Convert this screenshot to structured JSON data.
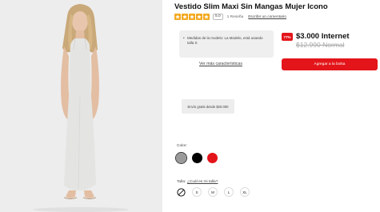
{
  "product": {
    "title": "Vestido Slim Maxi Sin Mangas Mujer Icono",
    "rating_value": "5.0",
    "review_count": "1 Reseña",
    "write_review": "Escribir un comentario",
    "measures_note": "Medidas de la modelo: La Modelo, está usando talla S",
    "more_features": "Ver más características",
    "shipping_note": "Envío gratis desde $20.000"
  },
  "pricing": {
    "discount_badge": "77%",
    "current_price": "$3.000 Internet",
    "old_price": "$12.990 Normal"
  },
  "actions": {
    "add_to_bag": "Agregar a la bolsa"
  },
  "colors": {
    "label": "Color:",
    "swatches": [
      {
        "name": "gray",
        "hex": "#9a9a9a",
        "selected": true
      },
      {
        "name": "black",
        "hex": "#000000",
        "selected": false
      },
      {
        "name": "red",
        "hex": "#e3151a",
        "selected": false
      }
    ]
  },
  "sizes": {
    "label": "Talla:",
    "guide_link": "¿Cuál es mi talla?",
    "options": [
      "S",
      "M",
      "L",
      "XL"
    ]
  },
  "theme": {
    "accent": "#e3151a",
    "star": "#f3a81e"
  }
}
